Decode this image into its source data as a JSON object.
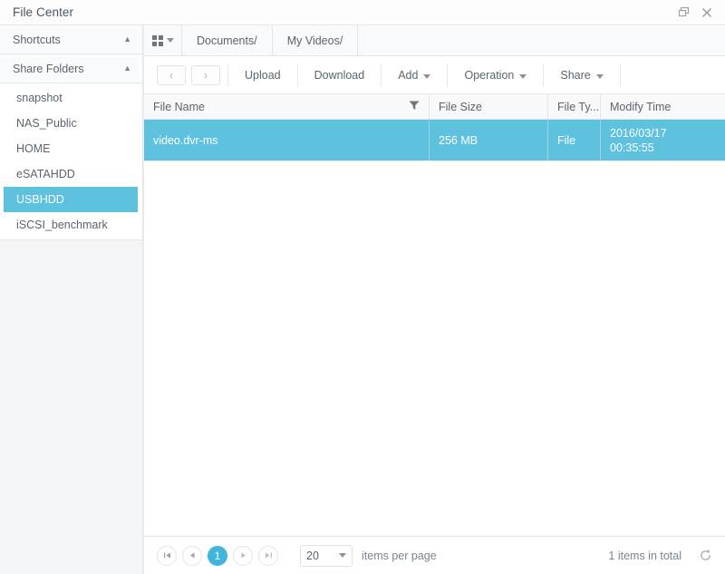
{
  "window": {
    "title": "File Center",
    "restore_icon": "restore-icon",
    "close_icon": "close-icon"
  },
  "sidebar": {
    "groups": [
      {
        "label": "Shortcuts",
        "caret": "▲",
        "items": []
      },
      {
        "label": "Share Folders",
        "caret": "▲",
        "items": [
          {
            "label": "snapshot",
            "selected": false
          },
          {
            "label": "NAS_Public",
            "selected": false
          },
          {
            "label": "HOME",
            "selected": false
          },
          {
            "label": "eSATAHDD",
            "selected": false
          },
          {
            "label": "USBHDD",
            "selected": true
          },
          {
            "label": "iSCSI_benchmark",
            "selected": false
          }
        ]
      }
    ]
  },
  "tabbar": {
    "view_icon": "grid-view-icon",
    "view_caret": "▼",
    "tabs": [
      {
        "label": "Documents/"
      },
      {
        "label": "My Videos/"
      }
    ]
  },
  "toolbar": {
    "back_icon": "‹",
    "forward_icon": "›",
    "buttons": [
      {
        "label": "Upload",
        "has_caret": false
      },
      {
        "label": "Download",
        "has_caret": false
      },
      {
        "label": "Add",
        "has_caret": true
      },
      {
        "label": "Operation",
        "has_caret": true
      },
      {
        "label": "Share",
        "has_caret": true
      }
    ]
  },
  "table": {
    "columns": [
      {
        "label": "File Name",
        "filter_icon": "filter-icon"
      },
      {
        "label": "File Size"
      },
      {
        "label": "File Ty..."
      },
      {
        "label": "Modify Time"
      }
    ],
    "rows": [
      {
        "file_name": "video.dvr-ms",
        "file_size": "256 MB",
        "file_type": "File",
        "modify_date": "2016/03/17",
        "modify_time": "00:35:55",
        "selected": true
      }
    ]
  },
  "footer": {
    "first_icon": "⧏|",
    "prev_icon": "◀",
    "page_label": "1",
    "next_icon": "▶",
    "last_icon": "|⧐",
    "per_page_value": "20",
    "per_page_caret": "▼",
    "per_page_label": "items per page",
    "total_label": "1 items in total",
    "refresh_icon": "refresh-icon"
  },
  "colors": {
    "accent": "#41b6dc",
    "selection": "#5ec1de",
    "text": "#5b646e",
    "border": "#e3e5e8"
  }
}
